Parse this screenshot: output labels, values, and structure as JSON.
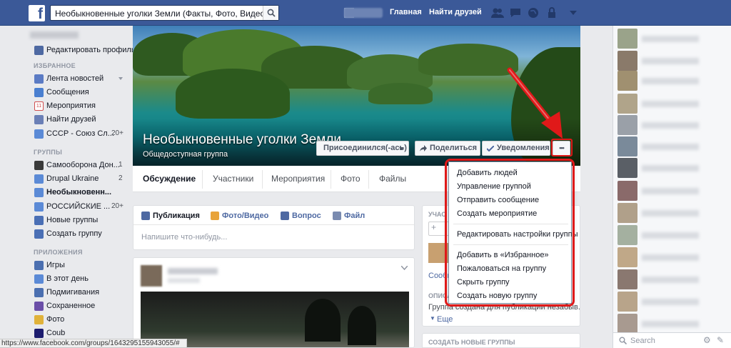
{
  "topbar": {
    "search_value": "Необыкновенные уголки Земли (Факты, Фото, Видео))",
    "home_link": "Главная",
    "find_friends_link": "Найти друзей",
    "accent": "#3b5998"
  },
  "leftnav": {
    "edit_profile": "Редактировать профиль",
    "favorites_header": "ИЗБРАННОЕ",
    "favorites": [
      {
        "label": "Лента новостей",
        "count": ""
      },
      {
        "label": "Сообщения",
        "count": ""
      },
      {
        "label": "Мероприятия",
        "count": ""
      },
      {
        "label": "Найти друзей",
        "count": ""
      },
      {
        "label": "СССР - Союз Сл...",
        "count": "20+"
      }
    ],
    "groups_header": "ГРУППЫ",
    "groups": [
      {
        "label": "Самооборона Дон...",
        "count": "1"
      },
      {
        "label": "Drupal Ukraine",
        "count": "2"
      },
      {
        "label": "Необыкновенн...",
        "count": ""
      },
      {
        "label": "РОССИЙСКИЕ ...",
        "count": "20+"
      },
      {
        "label": "Новые группы",
        "count": ""
      },
      {
        "label": "Создать группу",
        "count": ""
      }
    ],
    "apps_header": "ПРИЛОЖЕНИЯ",
    "apps": [
      {
        "label": "Игры"
      },
      {
        "label": "В этот день"
      },
      {
        "label": "Подмигивания"
      },
      {
        "label": "Сохраненное"
      },
      {
        "label": "Фото"
      },
      {
        "label": "Coub"
      }
    ],
    "calendar_day": "11"
  },
  "cover": {
    "group_title": "Необыкновенные уголки Земли",
    "group_type": "Общедоступная группа",
    "joined_button": "Присоединился(-ась)",
    "share_button": "Поделиться",
    "notifications_button": "Уведомления",
    "more_button": "•••"
  },
  "tabs": [
    "Обсуждение",
    "Участники",
    "Мероприятия",
    "Фото",
    "Файлы"
  ],
  "composer": {
    "actions": [
      "Публикация",
      "Фото/Видео",
      "Вопрос",
      "Файл"
    ],
    "placeholder": "Напишите что-нибудь..."
  },
  "right_column": {
    "members_header": "УЧАС",
    "subscribe_text": "Сообщ",
    "about_header": "ОПИСА",
    "about_text": "Группа создана для публикации незабыв...",
    "more_link": "Еще",
    "create_groups_header": "СОЗДАТЬ НОВЫЕ ГРУППЫ"
  },
  "dropdown": {
    "group1": [
      "Добавить людей",
      "Управление группой",
      "Отправить сообщение",
      "Создать мероприятие"
    ],
    "group2": [
      "Редактировать настройки группы"
    ],
    "group3": [
      "Добавить в «Избранное»",
      "Пожаловаться на группу",
      "Скрыть группу",
      "Создать новую группу"
    ],
    "highlight_color": "#e01919"
  },
  "chat": {
    "search_placeholder": "Search"
  },
  "statusbar": {
    "url": "https://www.facebook.com/groups/1643295155943055/#"
  }
}
